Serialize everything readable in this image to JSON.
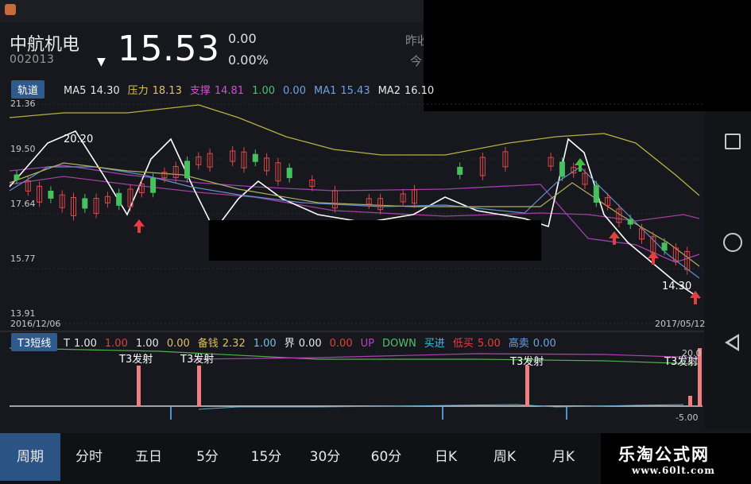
{
  "colors": {
    "ma5": "#e8e8e8",
    "pressure": "#e0c060",
    "support": "#c040c0",
    "ma_green": "#50c070",
    "ma1": "#70a0e0",
    "ma2": "#e8e8e8",
    "down": "#50c060",
    "up": "#e04040"
  },
  "header": {
    "stock_name": "中航机电",
    "stock_code": "002013",
    "arrow": "▼",
    "price": "15.53",
    "change_abs": "0.00",
    "change_pct": "0.00%",
    "prev_close_label": "昨收",
    "today_label": "今"
  },
  "main_chart": {
    "tag": "轨道",
    "legend": [
      {
        "label": "MA5",
        "value": "14.30",
        "color": "#e8e8e8"
      },
      {
        "label": "压力",
        "value": "18.13",
        "color": "#e0c060"
      },
      {
        "label": "支撑",
        "value": "14.81",
        "color": "#d050d0"
      },
      {
        "label": "",
        "value": "1.00",
        "color": "#50c070"
      },
      {
        "label": "",
        "value": "0.00",
        "color": "#70a0e0"
      },
      {
        "label": "MA1",
        "value": "15.43",
        "color": "#70a0e0"
      },
      {
        "label": "MA2",
        "value": "16.10",
        "color": "#e8e8e8"
      }
    ],
    "y_ticks": [
      "21.36",
      "19.50",
      "17.64",
      "15.77",
      "13.91"
    ],
    "date_start": "2016/12/06",
    "date_end": "2017/05/12",
    "annot_high": "20.20",
    "annot_low": "14.30"
  },
  "indicator": {
    "tag": "T3短线",
    "legend": [
      {
        "label": "T",
        "value": "1.00",
        "color": "#e8e8e8"
      },
      {
        "label": "",
        "value": "1.00",
        "color": "#e04040"
      },
      {
        "label": "",
        "value": "1.00",
        "color": "#e8e8e8"
      },
      {
        "label": "",
        "value": "0.00",
        "color": "#e0c060"
      },
      {
        "label": "备钱",
        "value": "2.32",
        "color": "#e0c060"
      },
      {
        "label": "",
        "value": "1.00",
        "color": "#70c0e0"
      },
      {
        "label": "界",
        "value": "0.00",
        "color": "#e8e8e8"
      },
      {
        "label": "",
        "value": "0.00",
        "color": "#e04040"
      },
      {
        "label": "UP",
        "value": "",
        "color": "#c040c0"
      },
      {
        "label": "DOWN",
        "value": "",
        "color": "#50c070"
      },
      {
        "label": "买进",
        "value": "",
        "color": "#40c0e0"
      },
      {
        "label": "低买",
        "value": "5.00",
        "color": "#e04040"
      },
      {
        "label": "高卖",
        "value": "0.00",
        "color": "#70a0e0"
      }
    ],
    "signal_label": "T3发射",
    "y_top": "20.0",
    "y_bottom": "-5.00"
  },
  "tabs": [
    "周期",
    "分时",
    "五日",
    "5分",
    "15分",
    "30分",
    "60分",
    "日K",
    "周K",
    "月K"
  ],
  "active_tab": "周期",
  "watermark": {
    "title": "乐淘公式网",
    "url": "www.60lt.com"
  }
}
